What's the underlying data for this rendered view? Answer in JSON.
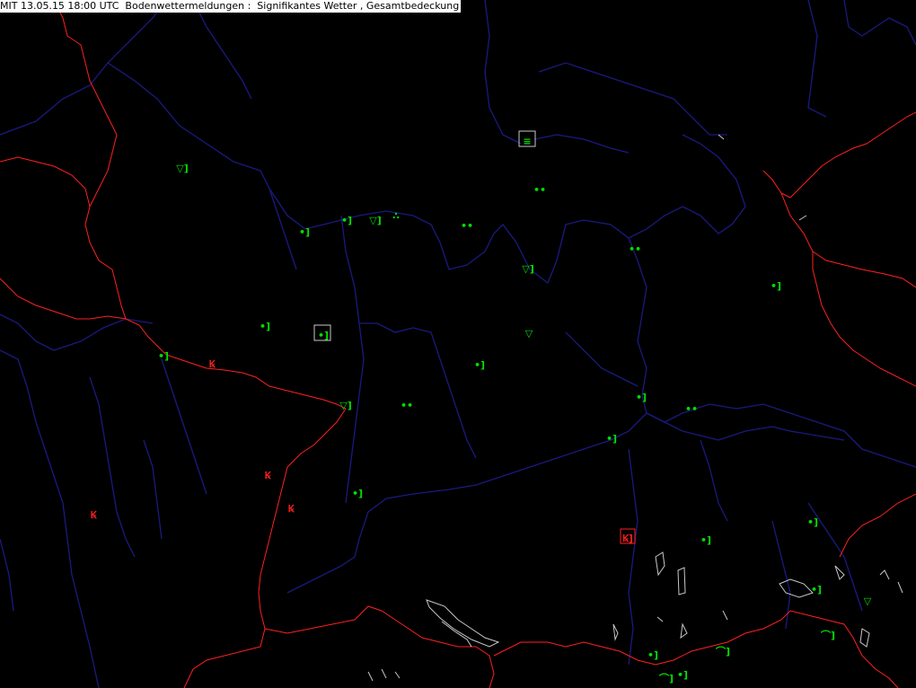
{
  "header": {
    "title": "MIT 13.05.15 18:00 UTC  Bodenwettermeldungen :  Signifikantes Wetter , Gesamtbedeckung"
  },
  "colors": {
    "background": "#000000",
    "borders": "#ff2020",
    "rivers": "#1a1a80",
    "lakes": "#c8c8c8",
    "symbol_normal": "#00e000",
    "symbol_thunder": "#ff2020",
    "highlight_box": "#c8c8c8"
  },
  "legend_note": "",
  "stations": [
    {
      "id": "st-01",
      "symbol": "rain-shower-icon",
      "glyph": "▽]",
      "color": "#00e000"
    },
    {
      "id": "st-02",
      "symbol": "fog-icon",
      "glyph": "≡",
      "color": "#00e000",
      "boxed": true
    },
    {
      "id": "st-03",
      "symbol": "drizzle-icon",
      "glyph": "••",
      "color": "#00e000"
    },
    {
      "id": "st-04",
      "symbol": "rain-icon",
      "glyph": "•]",
      "color": "#00e000"
    },
    {
      "id": "st-05",
      "symbol": "rain-icon",
      "glyph": "•]",
      "color": "#00e000"
    },
    {
      "id": "st-06",
      "symbol": "rain-shower-icon",
      "glyph": "▽]",
      "color": "#00e000"
    },
    {
      "id": "st-07",
      "symbol": "heavy-rain-icon",
      "glyph": "∴",
      "color": "#00e000"
    },
    {
      "id": "st-08",
      "symbol": "drizzle-icon",
      "glyph": "••",
      "color": "#00e000"
    },
    {
      "id": "st-09",
      "symbol": "drizzle-icon",
      "glyph": "••",
      "color": "#00e000"
    },
    {
      "id": "st-10",
      "symbol": "rain-shower-icon",
      "glyph": "▽]",
      "color": "#00e000"
    },
    {
      "id": "st-11",
      "symbol": "rain-icon",
      "glyph": "•]",
      "color": "#00e000"
    },
    {
      "id": "st-12",
      "symbol": "rain-icon",
      "glyph": "•]",
      "color": "#00e000"
    },
    {
      "id": "st-13",
      "symbol": "rain-icon",
      "glyph": "•]",
      "color": "#00e000",
      "boxed": true
    },
    {
      "id": "st-14",
      "symbol": "rain-shower-icon",
      "glyph": "▽",
      "color": "#00e000"
    },
    {
      "id": "st-15",
      "symbol": "rain-icon",
      "glyph": "•]",
      "color": "#00e000"
    },
    {
      "id": "st-16",
      "symbol": "thunderstorm-icon",
      "glyph": "Ꝃ",
      "color": "#ff2020"
    },
    {
      "id": "st-17",
      "symbol": "rain-icon",
      "glyph": "•]",
      "color": "#00e000"
    },
    {
      "id": "st-18",
      "symbol": "rain-shower-icon",
      "glyph": "▽]",
      "color": "#00e000"
    },
    {
      "id": "st-19",
      "symbol": "drizzle-icon",
      "glyph": "••",
      "color": "#00e000"
    },
    {
      "id": "st-20",
      "symbol": "rain-icon",
      "glyph": "•]",
      "color": "#00e000"
    },
    {
      "id": "st-21",
      "symbol": "drizzle-icon",
      "glyph": "••",
      "color": "#00e000"
    },
    {
      "id": "st-22",
      "symbol": "rain-icon",
      "glyph": "•]",
      "color": "#00e000"
    },
    {
      "id": "st-23",
      "symbol": "thunderstorm-icon",
      "glyph": "Ꝃ",
      "color": "#ff2020"
    },
    {
      "id": "st-24",
      "symbol": "rain-icon",
      "glyph": "•]",
      "color": "#00e000"
    },
    {
      "id": "st-25",
      "symbol": "thunderstorm-icon",
      "glyph": "Ꝃ",
      "color": "#ff2020"
    },
    {
      "id": "st-26",
      "symbol": "thunderstorm-icon",
      "glyph": "Ꝃ",
      "color": "#ff2020"
    },
    {
      "id": "st-27",
      "symbol": "thunderstorm-rain-icon",
      "glyph": "Ꝃ]",
      "color": "#ff2020",
      "boxed": true
    },
    {
      "id": "st-28",
      "symbol": "rain-icon",
      "glyph": "•]",
      "color": "#00e000"
    },
    {
      "id": "st-29",
      "symbol": "rain-icon",
      "glyph": "•]",
      "color": "#00e000"
    },
    {
      "id": "st-30",
      "symbol": "rain-icon",
      "glyph": "•]",
      "color": "#00e000"
    },
    {
      "id": "st-31",
      "symbol": "rain-shower-icon",
      "glyph": "▽",
      "color": "#00e000"
    },
    {
      "id": "st-32",
      "symbol": "rain-icon",
      "glyph": "•]",
      "color": "#00e000"
    },
    {
      "id": "st-33",
      "symbol": "rain-icon",
      "glyph": "•]",
      "color": "#00e000"
    },
    {
      "id": "st-34",
      "symbol": "cloud-icon",
      "glyph": "⌒]",
      "color": "#00e000"
    },
    {
      "id": "st-35",
      "symbol": "cloud-icon",
      "glyph": "⌒]",
      "color": "#00e000"
    },
    {
      "id": "st-36",
      "symbol": "cloud-icon",
      "glyph": "⌒]",
      "color": "#00e000"
    }
  ]
}
